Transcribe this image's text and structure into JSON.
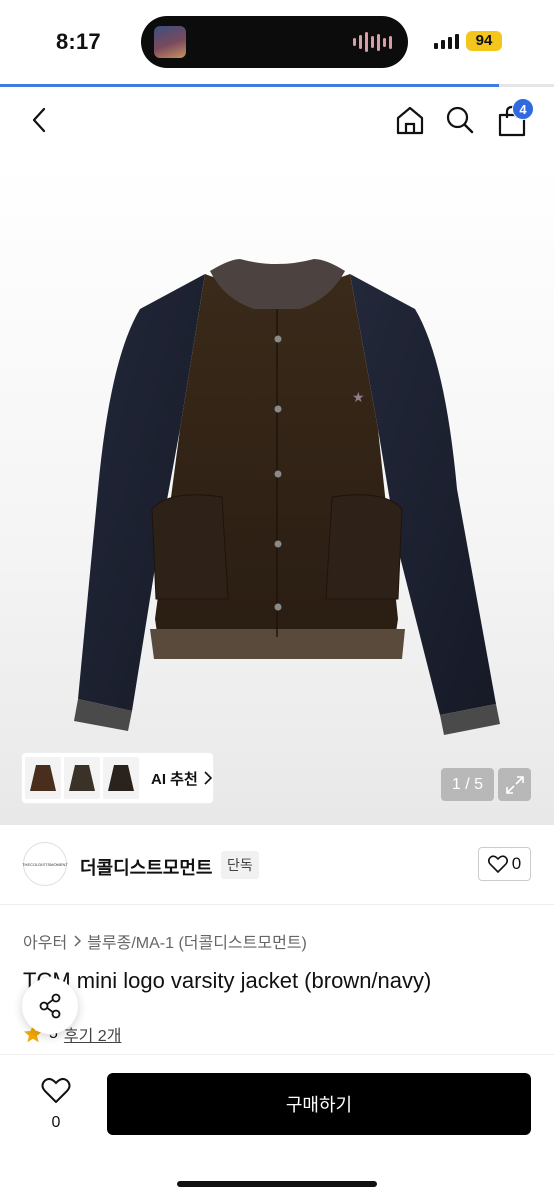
{
  "status_bar": {
    "time": "8:17",
    "battery": "94"
  },
  "page_progress": 0.9,
  "nav": {
    "cart_count": "4"
  },
  "gallery": {
    "page_indicator": "1 / 5",
    "ai_recommend_label": "AI 추천"
  },
  "brand": {
    "logo_text": "THECOLDISTSMOMENT",
    "name": "더콜디스트모먼트",
    "badge": "단독",
    "like_count": "0"
  },
  "breadcrumb": {
    "category": "아우터",
    "subcategory": "블루종/MA-1 (더콜디스트모먼트)"
  },
  "product": {
    "title": "TCM mini logo varsity jacket (brown/navy)",
    "rating": "5",
    "review_label": "후기 2개"
  },
  "bottom_bar": {
    "wish_count": "0",
    "buy_label": "구매하기"
  },
  "colors": {
    "accent": "#2f6ae0",
    "battery": "#f4c51a",
    "buy_button": "#000000",
    "star": "#f2a900"
  }
}
